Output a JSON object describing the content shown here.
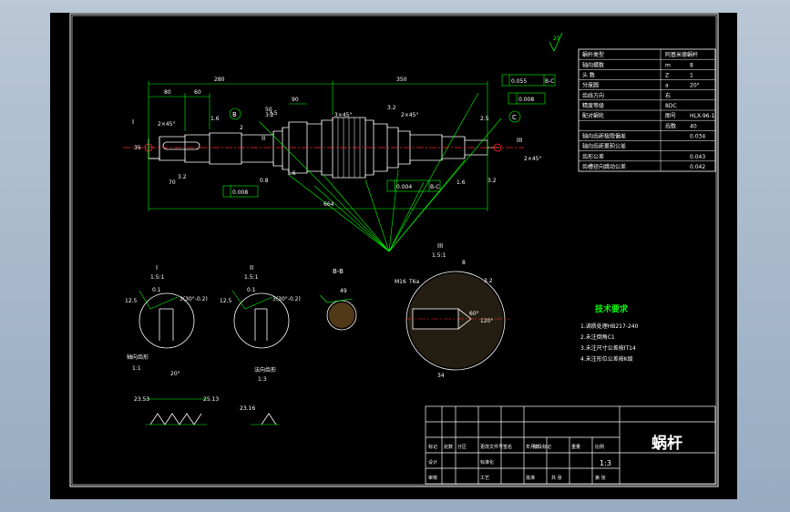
{
  "drawing": {
    "title_cn": "蜗杆",
    "scale": "1:3",
    "roughness_corner": "25",
    "colors": {
      "background": "#000000",
      "frame": "#ffffff",
      "dims": "#00ff00",
      "text": "#ffffff",
      "centerline": "#ff2a2a",
      "tech_title": "#00ff00"
    }
  },
  "params_table": [
    [
      "蜗杆类型",
      "阿基米德蜗杆"
    ],
    [
      "轴向模数",
      "m",
      "8"
    ],
    [
      "头  数",
      "Z",
      "1"
    ],
    [
      "分度圆",
      "a",
      "20°"
    ],
    [
      "齿线方向",
      "右"
    ],
    [
      "精度等级",
      "8DC"
    ],
    [
      "配对蜗轮",
      "图号",
      "HLX-96-1"
    ],
    [
      "",
      "齿数",
      "40"
    ],
    [
      "轴向齿距极限偏差",
      "",
      "0.034"
    ],
    [
      "轴向齿距累积公差",
      ""
    ],
    [
      "齿形公差",
      "",
      "0.043"
    ],
    [
      "齿槽径向跳动公差",
      "",
      "0.042"
    ]
  ],
  "dims": {
    "d280": "280",
    "d350": "350",
    "d80": "80",
    "d60": "60",
    "d90": "90",
    "d50": "50",
    "d2": "2",
    "d664": "664",
    "d70": "70",
    "d35": "35",
    "c2x45a": "2×45°",
    "c2x45b": "2×45°",
    "c2x45c": "2×45°",
    "c3x45": "3×45°",
    "r16": "1.6",
    "r32a": "3.2",
    "r32b": "3.2",
    "r08": "0.8",
    "r32c": "3.2",
    "r16b": "1.6",
    "r16c": "1.6",
    "r32d": "3.2",
    "r25": "25",
    "r25b": "2.5",
    "d085": "0.085",
    "d008": "0.008",
    "d005": "0.005",
    "tol1": "0.055",
    "tol2": "0.004",
    "tol3": "0.008",
    "ref": "B-C",
    "ref2": "B-C",
    "ref3": "B-C",
    "mark_i": "I",
    "mark_ii": "II",
    "mark_iii": "III",
    "mark_b": "B",
    "mark_c": "C",
    "a3_5": "3.5"
  },
  "details": {
    "sec_i_title": "I",
    "sec_i_scale": "1.5:1",
    "sec_ii_title": "II",
    "sec_ii_scale": "1.5:1",
    "sec_bb": "B-B",
    "sec_iii_title": "III",
    "sec_iii_scale": "1.5:1",
    "i_d1": "12.5",
    "i_d2": "0.1",
    "i_d3": "3(30°-0.2)",
    "ii_d1": "12.5",
    "ii_d2": "0.1",
    "ii_d3": "3(30°-0.2)",
    "bb_d1": "49",
    "iii_d1": "M16",
    "iii_d2": "T6a",
    "iii_d3": "60°",
    "iii_d4": "120°",
    "iii_d5": "34",
    "iii_d6": "8",
    "iii_d7": "3.2",
    "tooth_title": "轴向齿形",
    "tooth_scale": "1:1",
    "normal_title": "法向齿形",
    "normal_scale": "1:3",
    "t1": "23.53",
    "t2": "25.13",
    "t3": "20°",
    "t4": "23.16"
  },
  "tech": {
    "title": "技术要求",
    "items": [
      "1.调质处理HB217-240",
      "2.未注倒角C1",
      "3.未注尺寸公差按IT14",
      "4.未注形位公差按K级"
    ]
  },
  "title_block": {
    "labels": [
      "标记",
      "处数",
      "分区",
      "更改文件号",
      "签名",
      "年月日",
      "设计",
      "标准化",
      "审核",
      "工艺",
      "批准",
      "阶段标记",
      "重量",
      "比例",
      "共 张",
      "第 张"
    ]
  }
}
